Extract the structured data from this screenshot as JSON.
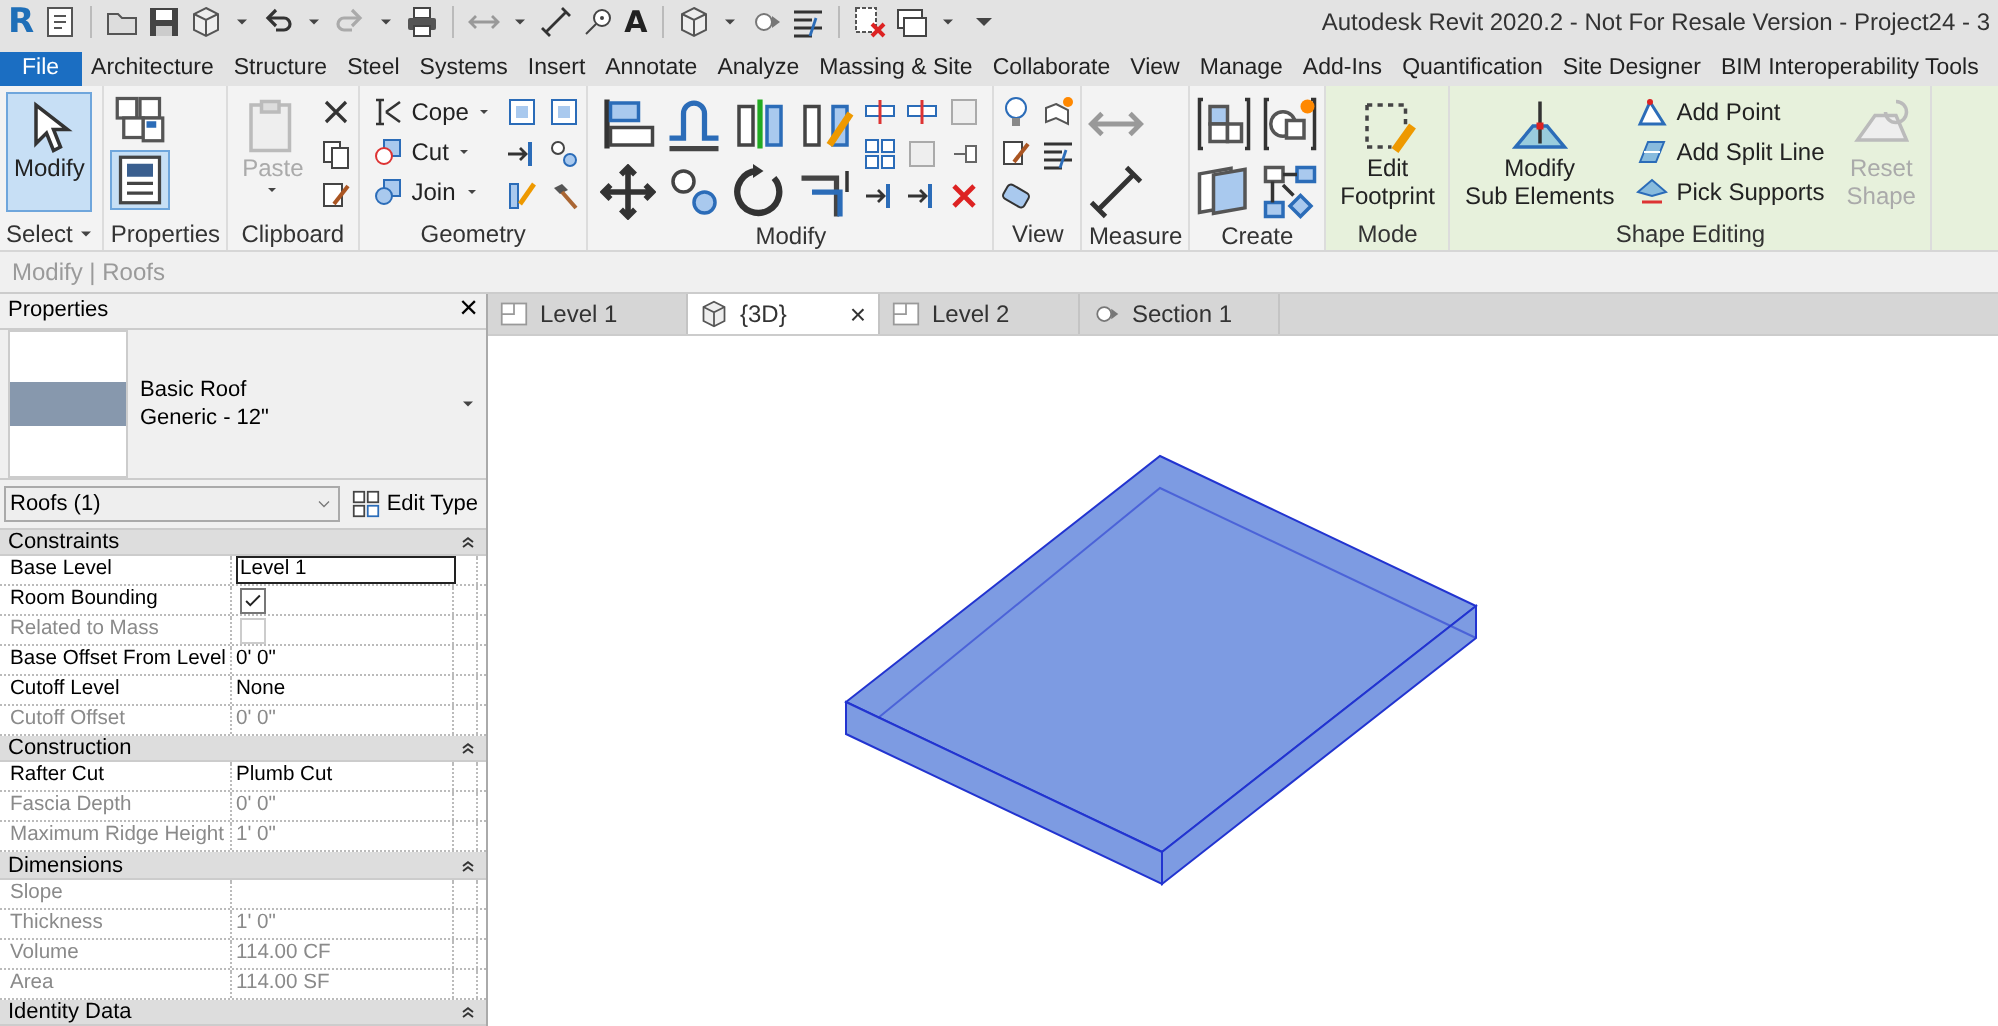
{
  "window": {
    "title": "Autodesk Revit 2020.2 - Not For Resale Version - Project24 - 3"
  },
  "quick_access": {
    "logo": "R",
    "text_glyph": "A"
  },
  "menu_tabs": [
    {
      "label": "File",
      "kind": "file"
    },
    {
      "label": "Architecture",
      "kind": "tab"
    },
    {
      "label": "Structure",
      "kind": "tab"
    },
    {
      "label": "Steel",
      "kind": "tab"
    },
    {
      "label": "Systems",
      "kind": "tab"
    },
    {
      "label": "Insert",
      "kind": "tab"
    },
    {
      "label": "Annotate",
      "kind": "tab"
    },
    {
      "label": "Analyze",
      "kind": "tab"
    },
    {
      "label": "Massing & Site",
      "kind": "tab"
    },
    {
      "label": "Collaborate",
      "kind": "tab"
    },
    {
      "label": "View",
      "kind": "tab"
    },
    {
      "label": "Manage",
      "kind": "tab"
    },
    {
      "label": "Add-Ins",
      "kind": "tab"
    },
    {
      "label": "Quantification",
      "kind": "tab"
    },
    {
      "label": "Site Designer",
      "kind": "tab"
    },
    {
      "label": "BIM Interoperability Tools",
      "kind": "tab"
    }
  ],
  "ribbon": {
    "panels": [
      {
        "title": "Select",
        "dropdown": true,
        "tools": [
          {
            "kind": "large",
            "lines": [
              "Modify"
            ],
            "selected": true,
            "disabled": false
          }
        ]
      },
      {
        "title": "Properties",
        "tools": [
          {
            "kind": "toggle",
            "selected": true
          }
        ]
      },
      {
        "title": "Clipboard",
        "tools": [
          {
            "kind": "large",
            "lines": [
              "Paste"
            ],
            "selected": false,
            "disabled": true,
            "dropdown": true
          }
        ]
      },
      {
        "title": "Geometry",
        "tools": [
          {
            "kind": "small",
            "label": "Cope",
            "selected": false,
            "disabled": false,
            "dropdown": true
          },
          {
            "kind": "small",
            "label": "Cut",
            "selected": false,
            "disabled": false,
            "dropdown": true
          },
          {
            "kind": "small",
            "label": "Join",
            "selected": false,
            "disabled": false,
            "dropdown": true
          }
        ]
      },
      {
        "title": "Modify"
      },
      {
        "title": "View"
      },
      {
        "title": "Measure"
      },
      {
        "title": "Create"
      },
      {
        "title": "Mode",
        "contextual": true,
        "tools": [
          {
            "kind": "large",
            "lines": [
              "Edit",
              "Footprint"
            ],
            "selected": false,
            "disabled": false
          }
        ]
      },
      {
        "title": "Shape Editing",
        "contextual": true,
        "tools": [
          {
            "kind": "large",
            "lines": [
              "Modify",
              "Sub Elements"
            ],
            "selected": false,
            "disabled": false
          },
          {
            "kind": "small",
            "label": "Add Point",
            "selected": false,
            "disabled": false
          },
          {
            "kind": "small",
            "label": "Add Split Line",
            "selected": false,
            "disabled": false
          },
          {
            "kind": "small",
            "label": "Pick Supports",
            "selected": false,
            "disabled": false
          },
          {
            "kind": "large",
            "lines": [
              "Reset",
              "Shape"
            ],
            "selected": false,
            "disabled": true
          }
        ]
      }
    ]
  },
  "context_bar": "Modify | Roofs",
  "properties": {
    "title": "Properties",
    "close": "×",
    "type_name": "Basic Roof",
    "type_detail": "Generic - 12\"",
    "instance_filter": "Roofs (1)",
    "edit_type": "Edit Type",
    "groups": [
      {
        "name": "Constraints",
        "rows": [
          {
            "label": "Base Level",
            "value": "Level 1",
            "kind": "input",
            "disabled": false
          },
          {
            "label": "Room Bounding",
            "kind": "checkbox",
            "checked": true,
            "disabled": false
          },
          {
            "label": "Related to Mass",
            "kind": "checkbox",
            "checked": false,
            "disabled": true
          },
          {
            "label": "Base Offset From Level",
            "value": "0'  0\"",
            "kind": "text",
            "disabled": false
          },
          {
            "label": "Cutoff Level",
            "value": "None",
            "kind": "text",
            "disabled": false
          },
          {
            "label": "Cutoff Offset",
            "value": "0'  0\"",
            "kind": "text",
            "disabled": true
          }
        ]
      },
      {
        "name": "Construction",
        "rows": [
          {
            "label": "Rafter Cut",
            "value": "Plumb Cut",
            "kind": "text",
            "disabled": false
          },
          {
            "label": "Fascia Depth",
            "value": "0'  0\"",
            "kind": "text",
            "disabled": true
          },
          {
            "label": "Maximum Ridge Height",
            "value": "1'  0\"",
            "kind": "text",
            "disabled": true
          }
        ]
      },
      {
        "name": "Dimensions",
        "rows": [
          {
            "label": "Slope",
            "kind": "text",
            "disabled": true
          },
          {
            "label": "Thickness",
            "value": "1'  0\"",
            "kind": "text",
            "disabled": true
          },
          {
            "label": "Volume",
            "value": "114.00 CF",
            "kind": "text",
            "disabled": true
          },
          {
            "label": "Area",
            "value": "114.00 SF",
            "kind": "text",
            "disabled": true
          }
        ]
      },
      {
        "name": "Identity Data"
      }
    ]
  },
  "view_tabs": [
    {
      "label": "Level 1",
      "kind": "plan",
      "selected": false
    },
    {
      "label": "{3D}",
      "kind": "model",
      "selected": true,
      "close": "×"
    },
    {
      "label": "Level 2",
      "kind": "plan",
      "selected": false
    },
    {
      "label": "Section 1",
      "kind": "section",
      "selected": false
    }
  ]
}
